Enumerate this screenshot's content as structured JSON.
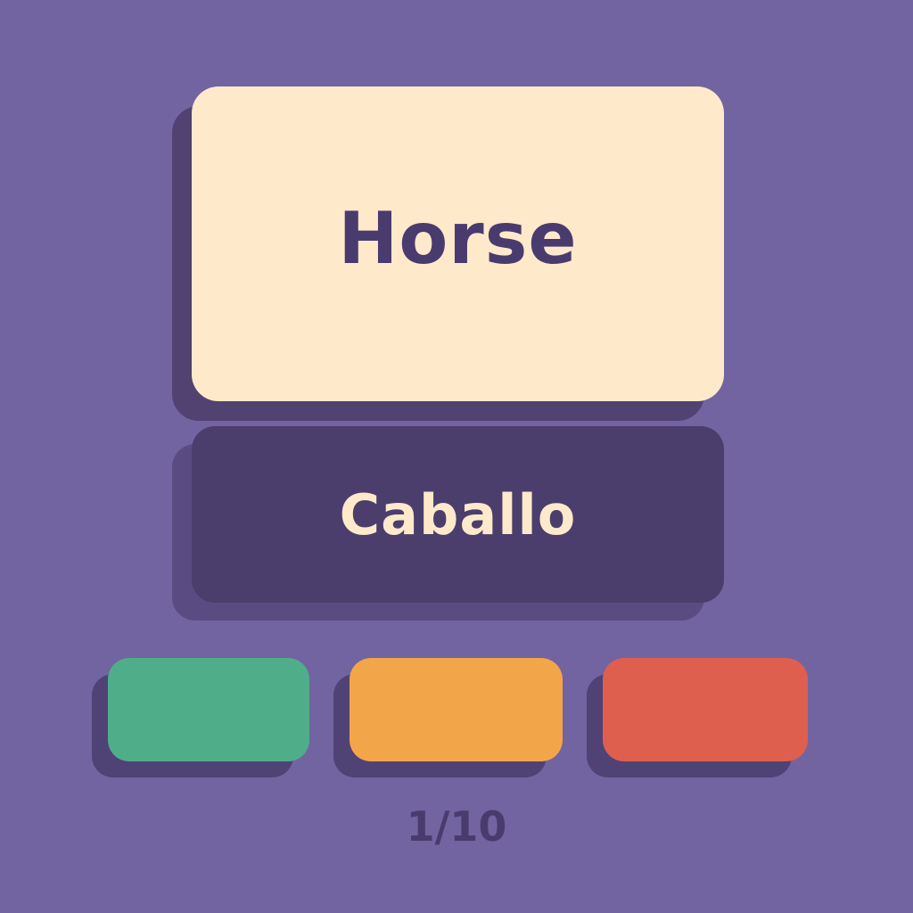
{
  "card": {
    "word": "Horse",
    "translation": "Caballo"
  },
  "rating_buttons": [
    {
      "color": "#4fae89"
    },
    {
      "color": "#f3a54a"
    },
    {
      "color": "#de5f4e"
    }
  ],
  "progress": {
    "text": "1/10",
    "current": 1,
    "total": 10
  },
  "colors": {
    "background": "#7264a1",
    "card_front": "#feeacb",
    "card_back": "#4b3e6c",
    "text_dark": "#4a3b6e"
  }
}
